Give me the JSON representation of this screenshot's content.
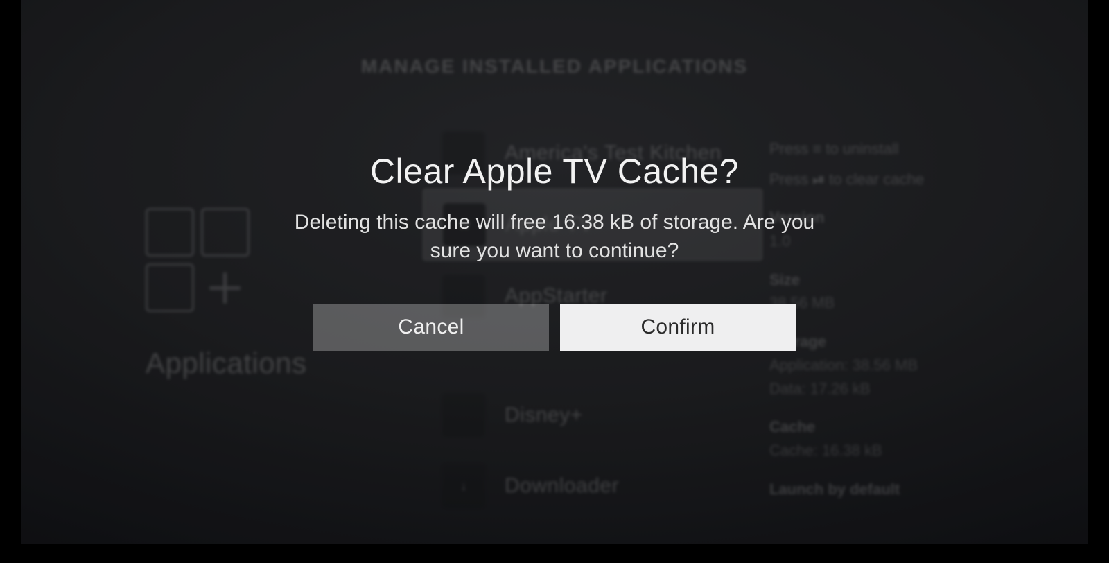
{
  "header": {
    "title": "MANAGE INSTALLED APPLICATIONS"
  },
  "left": {
    "title": "Applications"
  },
  "list": {
    "items": [
      {
        "label": "America's Test Kitchen"
      },
      {
        "label": "Apple TV"
      },
      {
        "label": "AppStarter"
      },
      {
        "label": "Disney+"
      },
      {
        "label": "Downloader"
      }
    ],
    "selected_index": 1
  },
  "right": {
    "hints": [
      {
        "prefix": "Press",
        "key": "≡",
        "label": "to uninstall"
      },
      {
        "prefix": "Press",
        "key": "⏯",
        "label": "to clear cache"
      }
    ],
    "sections": [
      {
        "header": "Version",
        "lines": [
          "1.0"
        ]
      },
      {
        "header": "Size",
        "lines": [
          "38.56 MB"
        ]
      },
      {
        "header": "Storage",
        "lines": [
          "Application: 38.56 MB",
          "Data: 17.26 kB"
        ]
      },
      {
        "header": "Cache",
        "lines": [
          "Cache: 16.38 kB"
        ]
      },
      {
        "header": "Launch by default",
        "lines": []
      }
    ]
  },
  "dialog": {
    "title": "Clear Apple TV Cache?",
    "body": "Deleting this cache will free 16.38 kB of storage. Are you sure you want to continue?",
    "cancel_label": "Cancel",
    "confirm_label": "Confirm"
  }
}
